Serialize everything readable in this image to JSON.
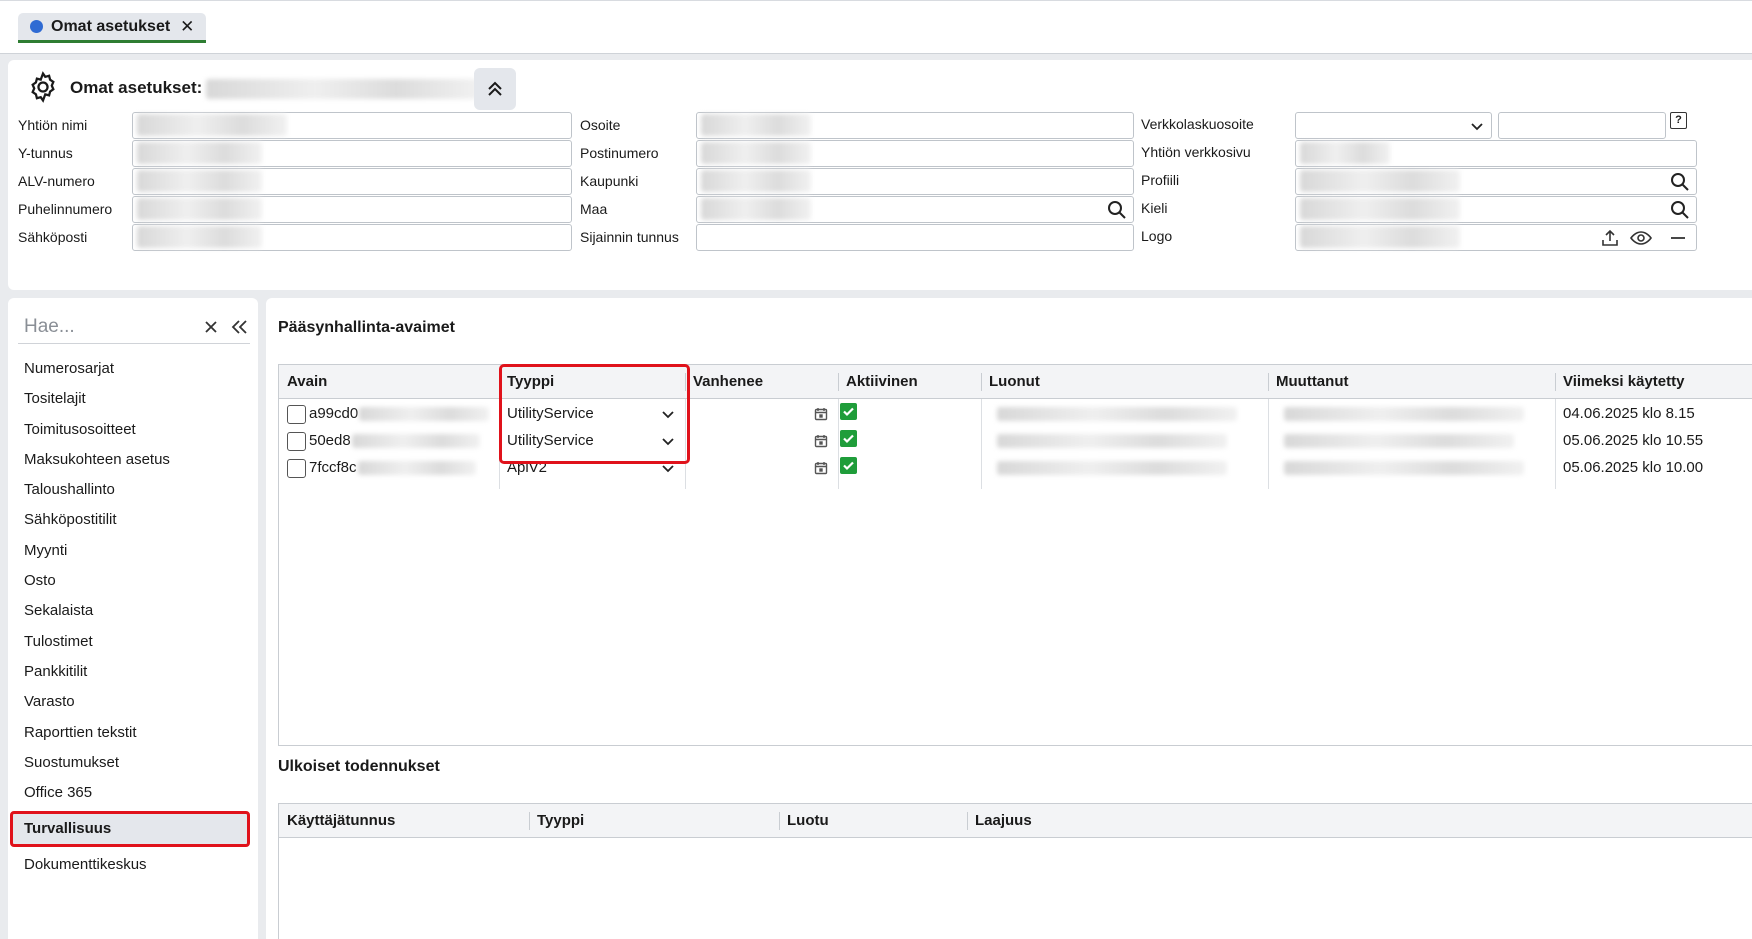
{
  "tab": {
    "label": "Omat asetukset",
    "close": "✕"
  },
  "header": {
    "title": "Omat asetukset:"
  },
  "form": {
    "company_name_label": "Yhtiön nimi",
    "business_id_label": "Y-tunnus",
    "vat_label": "ALV-numero",
    "phone_label": "Puhelinnumero",
    "email_label": "Sähköposti",
    "address_label": "Osoite",
    "postal_label": "Postinumero",
    "city_label": "Kaupunki",
    "country_label": "Maa",
    "location_id_label": "Sijainnin tunnus",
    "einvoice_label": "Verkkolaskuosoite",
    "website_label": "Yhtiön verkkosivu",
    "profile_label": "Profiili",
    "language_label": "Kieli",
    "logo_label": "Logo",
    "help": "?"
  },
  "sidebar": {
    "search_placeholder": "Hae...",
    "items": [
      "Numerosarjat",
      "Tositelajit",
      "Toimitusosoitteet",
      "Maksukohteen asetus",
      "Taloushallinto",
      "Sähköpostitilit",
      "Myynti",
      "Osto",
      "Sekalaista",
      "Tulostimet",
      "Pankkitilit",
      "Varasto",
      "Raporttien tekstit",
      "Suostumukset",
      "Office 365",
      "Turvallisuus",
      "Dokumenttikeskus"
    ],
    "active_index": 15
  },
  "keys": {
    "title": "Pääsynhallinta-avaimet",
    "columns": [
      "Avain",
      "Tyyppi",
      "Vanhenee",
      "Aktiivinen",
      "Luonut",
      "Muuttanut",
      "Viimeksi käytetty"
    ],
    "rows": [
      {
        "key": "a99cd0",
        "type": "UtilityService",
        "active": true,
        "last_used": "04.06.2025 klo 8.15"
      },
      {
        "key": "50ed8",
        "type": "UtilityService",
        "active": true,
        "last_used": "05.06.2025 klo 10.55"
      },
      {
        "key": "7fccf8c",
        "type": "ApiV2",
        "active": true,
        "last_used": "05.06.2025 klo 10.00"
      }
    ]
  },
  "external": {
    "title": "Ulkoiset todennukset",
    "columns": [
      "Käyttäjätunnus",
      "Tyyppi",
      "Luotu",
      "Laajuus"
    ]
  },
  "colors": {
    "accent_green": "#1f9d3a",
    "highlight_red": "#e0121b",
    "tab_dot": "#2f6bd3"
  }
}
